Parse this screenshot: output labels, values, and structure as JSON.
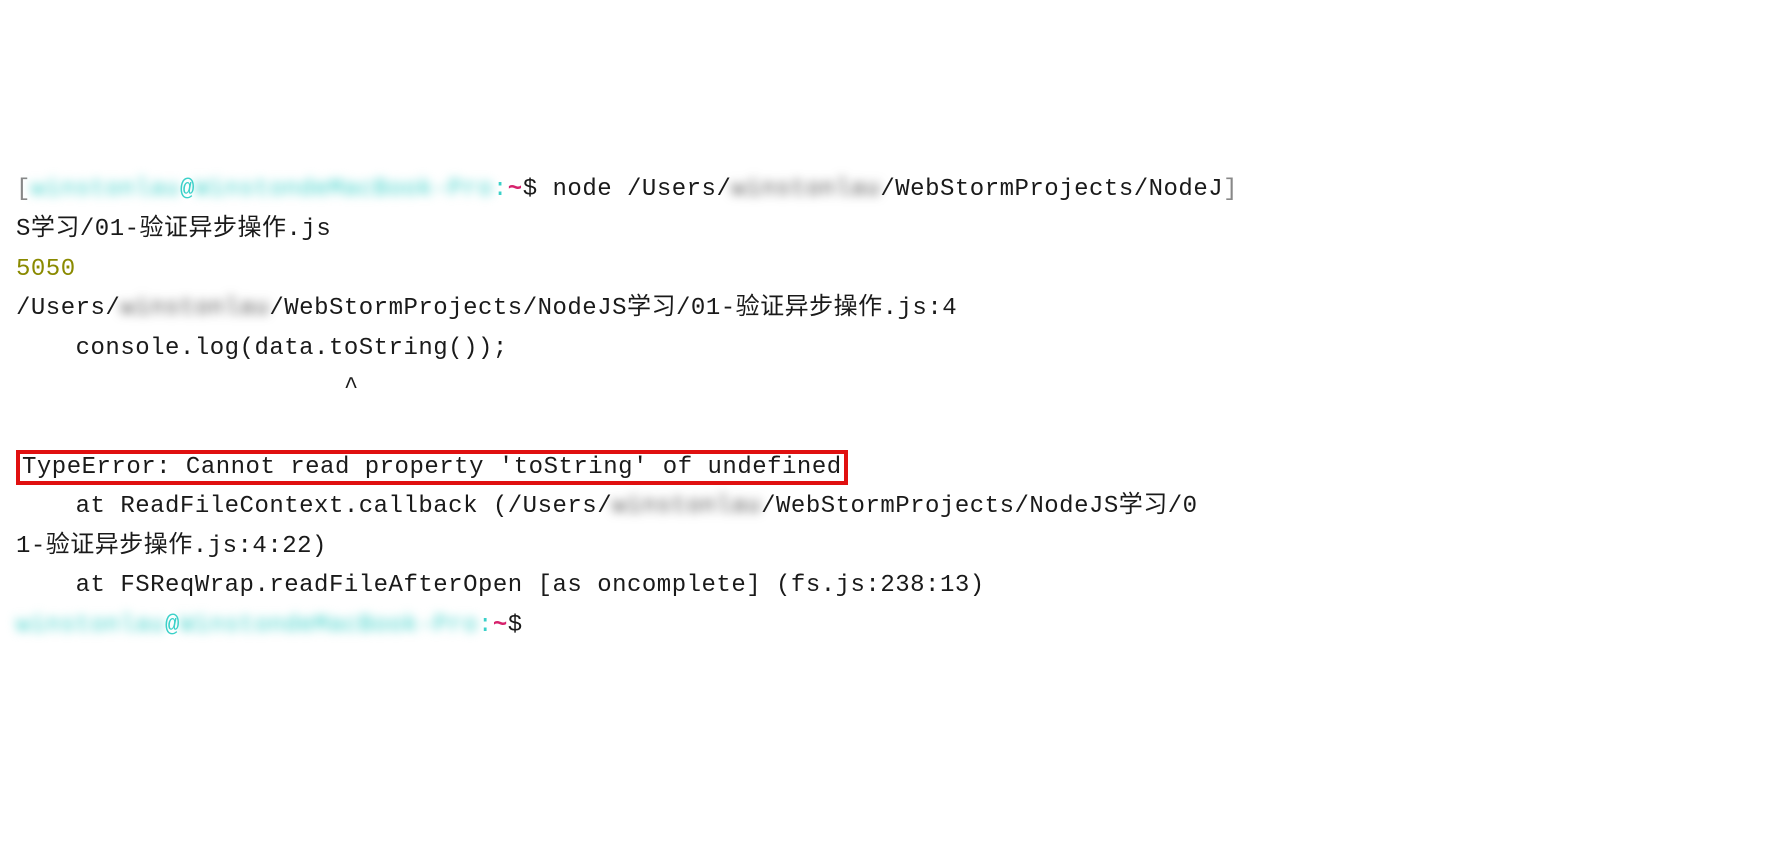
{
  "prompt1": {
    "bracket_open": "[",
    "user": "winstonlau",
    "at": "@",
    "host": "WinstondeMacBook-Pro",
    "colon": ":",
    "tilde": "~",
    "dollar": "$ ",
    "cmd_prefix": "node /Users/",
    "cmd_blurred": "winstonlau",
    "cmd_suffix1": "/WebStormProjects/NodeJ",
    "bracket_close": "]",
    "cmd_suffix2": "S学习/01-验证异步操作.js"
  },
  "output_number": "5050",
  "error_path": {
    "prefix": "/Users/",
    "blurred": "winstonlau",
    "suffix": "/WebStormProjects/NodeJS学习/01-验证异步操作.js:4"
  },
  "code_line": "    console.log(data.toString());",
  "caret_line": "                      ^",
  "error_message": "TypeError: Cannot read property 'toString' of undefined",
  "stack1": {
    "prefix": "    at ReadFileContext.callback (/Users/",
    "blurred": "winstonlau",
    "middle": "/WebStormProjects/NodeJS学习/0",
    "suffix": "1-验证异步操作.js:4:22)"
  },
  "stack2": "    at FSReqWrap.readFileAfterOpen [as oncomplete] (fs.js:238:13)",
  "prompt2": {
    "user": "winstonlau",
    "at": "@",
    "host": "WinstondeMacBook-Pro",
    "colon": ":",
    "tilde": "~",
    "dollar": "$"
  }
}
